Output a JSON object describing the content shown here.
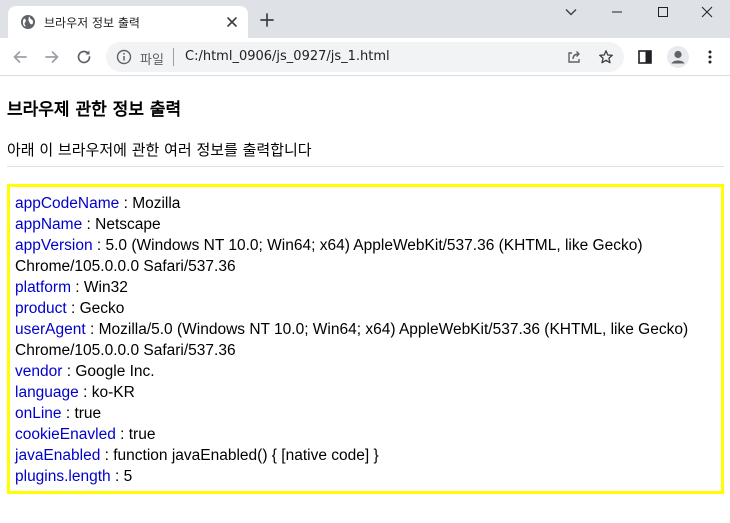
{
  "tab": {
    "title": "브라우저 정보 출력"
  },
  "address": {
    "scheme": "파일",
    "url": "C:/html_0906/js_0927/js_1.html"
  },
  "page": {
    "heading": "브라우제 관한 정보 출력",
    "intro": "아래 이 브라우저에 관한 여러 정보를 출력합니다",
    "separator": " : ",
    "info": [
      {
        "key": "appCodeName",
        "value": "Mozilla"
      },
      {
        "key": "appName",
        "value": "Netscape"
      },
      {
        "key": "appVersion",
        "value": "5.0 (Windows NT 10.0; Win64; x64) AppleWebKit/537.36 (KHTML, like Gecko) Chrome/105.0.0.0 Safari/537.36"
      },
      {
        "key": "platform",
        "value": "Win32"
      },
      {
        "key": "product",
        "value": "Gecko"
      },
      {
        "key": "userAgent",
        "value": "Mozilla/5.0 (Windows NT 10.0; Win64; x64) AppleWebKit/537.36 (KHTML, like Gecko) Chrome/105.0.0.0 Safari/537.36"
      },
      {
        "key": "vendor",
        "value": "Google Inc."
      },
      {
        "key": "language",
        "value": "ko-KR"
      },
      {
        "key": "onLine",
        "value": "true"
      },
      {
        "key": "cookieEnavled",
        "value": "true"
      },
      {
        "key": "javaEnabled",
        "value": "function javaEnabled() { [native code] }"
      },
      {
        "key": "plugins.length",
        "value": "5"
      }
    ]
  },
  "icons": {
    "favicon": "globe-icon",
    "tab_close": "close-icon",
    "new_tab": "plus-icon",
    "back": "arrow-left-icon",
    "forward": "arrow-right-icon",
    "reload": "reload-icon",
    "site_info": "info-icon",
    "share": "share-icon",
    "bookmark": "star-icon",
    "side_panel": "side-panel-icon",
    "profile": "profile-icon",
    "menu": "kebab-menu-icon"
  },
  "colors": {
    "tabstrip": "#dee1e6",
    "omnibox": "#f1f3f4",
    "info_key": "#0000cd",
    "info_border": "#ffff00"
  }
}
